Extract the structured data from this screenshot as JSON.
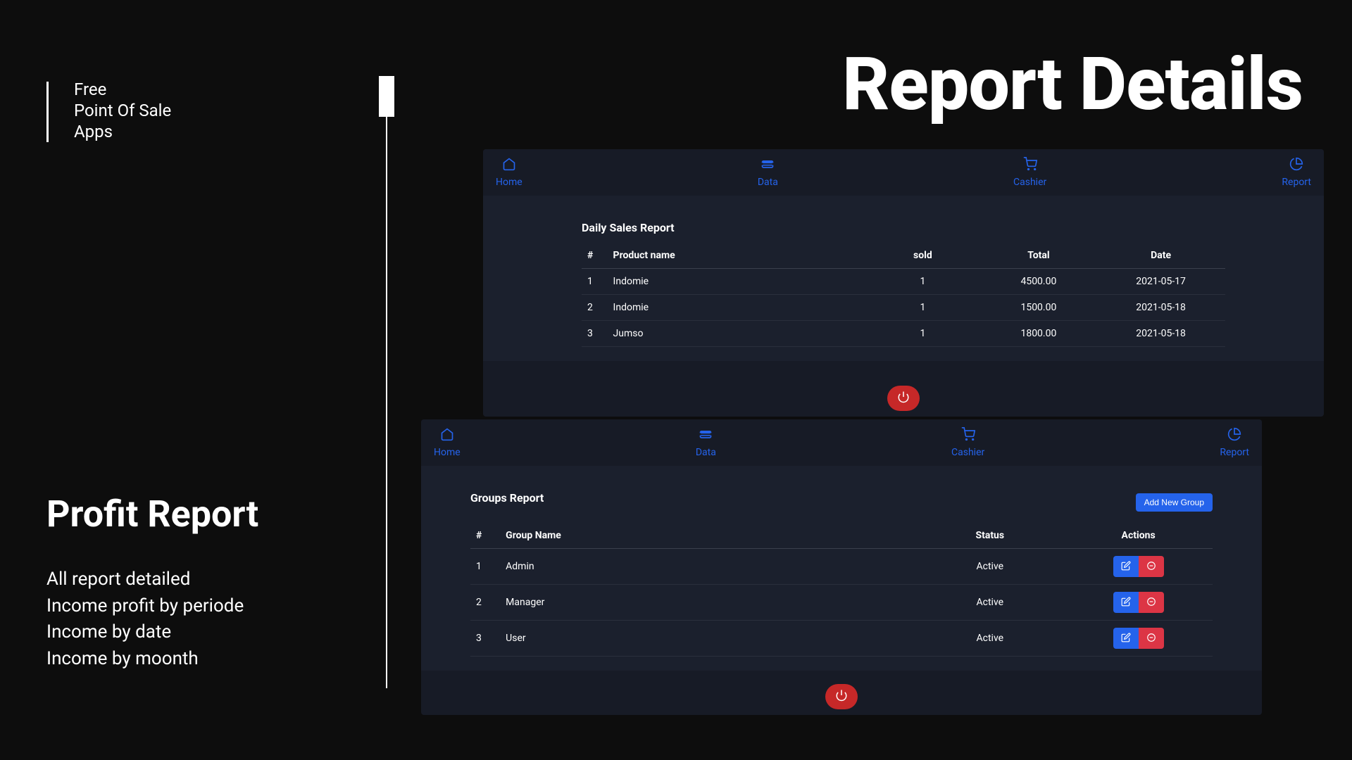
{
  "brand": {
    "l1": "Free",
    "l2": "Point Of Sale",
    "l3": "Apps"
  },
  "page_title": "Report Details",
  "profit": {
    "title": "Profit Report",
    "l1": "All report detailed",
    "l2": "Income profit by periode",
    "l3": "Income by date",
    "l4": "Income by moonth"
  },
  "nav": {
    "home": "Home",
    "data": "Data",
    "cashier": "Cashier",
    "report": "Report"
  },
  "sales_card": {
    "title": "Daily Sales Report",
    "headers": {
      "num": "#",
      "product": "Product name",
      "sold": "sold",
      "total": "Total",
      "date": "Date"
    },
    "rows": [
      {
        "num": "1",
        "product": "Indomie",
        "sold": "1",
        "total": "4500.00",
        "date": "2021-05-17"
      },
      {
        "num": "2",
        "product": "Indomie",
        "sold": "1",
        "total": "1500.00",
        "date": "2021-05-18"
      },
      {
        "num": "3",
        "product": "Jumso",
        "sold": "1",
        "total": "1800.00",
        "date": "2021-05-18"
      }
    ]
  },
  "groups_card": {
    "title": "Groups Report",
    "add_btn": "Add New Group",
    "headers": {
      "num": "#",
      "group": "Group Name",
      "status": "Status",
      "actions": "Actions"
    },
    "rows": [
      {
        "num": "1",
        "group": "Admin",
        "status": "Active"
      },
      {
        "num": "2",
        "group": "Manager",
        "status": "Active"
      },
      {
        "num": "3",
        "group": "User",
        "status": "Active"
      }
    ]
  }
}
